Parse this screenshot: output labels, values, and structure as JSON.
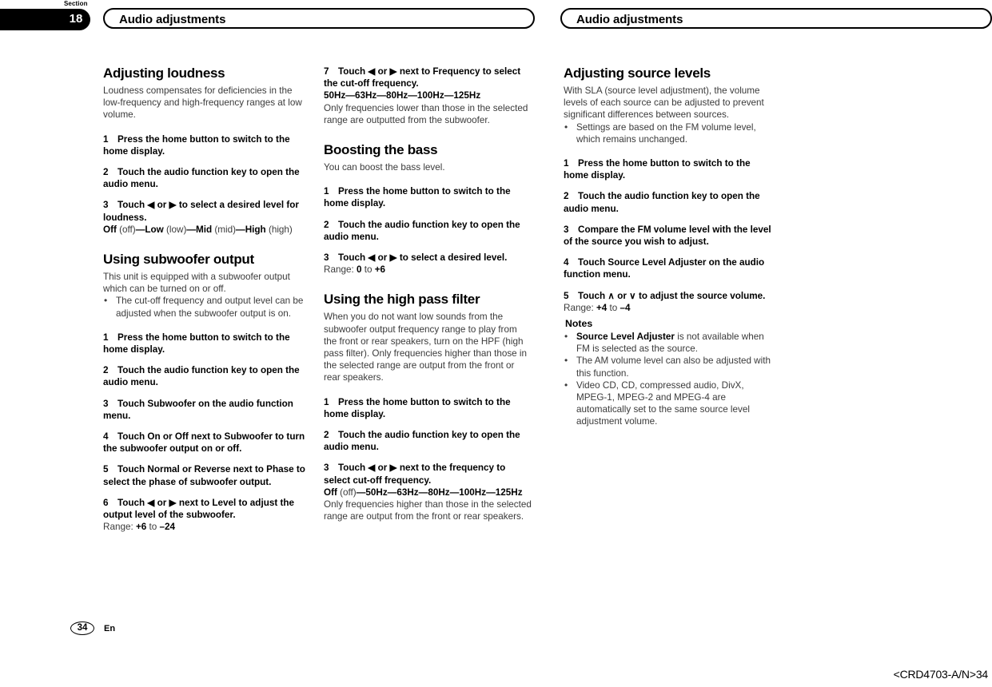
{
  "header": {
    "section_word": "Section",
    "section_number": "18",
    "left_title": "Audio adjustments",
    "right_title": "Audio adjustments"
  },
  "footer": {
    "page_number": "34",
    "language_code": "En",
    "doc_code": "<CRD4703-A/N>34"
  },
  "columns": {
    "col1": {
      "s1": {
        "title": "Adjusting loudness",
        "intro": "Loudness compensates for deficiencies in the low-frequency and high-frequency ranges at low volume.",
        "step1": "Press the home button to switch to the home display.",
        "step2": "Touch the audio function key to open the audio menu.",
        "step3": "Touch ◀ or ▶ to select a desired level for loudness.",
        "opt_off": "Off",
        "opt_off_lc": "(off)",
        "opt_low": "Low",
        "opt_low_lc": "(low)",
        "opt_mid": "Mid",
        "opt_mid_lc": "(mid)",
        "opt_high": "High",
        "opt_high_lc": "(high)",
        "dash": "—"
      },
      "s2": {
        "title": "Using subwoofer output",
        "intro": "This unit is equipped with a subwoofer output which can be turned on or off.",
        "bullet1": "The cut-off frequency and output level can be adjusted when the subwoofer output is on.",
        "step1": "Press the home button to switch to the home display.",
        "step2": "Touch the audio function key to open the audio menu.",
        "step3": "Touch Subwoofer on the audio function menu.",
        "step4": "Touch On or Off next to Subwoofer to turn the subwoofer output on or off.",
        "step5": "Touch Normal or Reverse next to Phase to select the phase of subwoofer output.",
        "step6": "Touch ◀ or ▶ next to Level to adjust the output level of the subwoofer.",
        "range_label": "Range: ",
        "range_from": "+6",
        "range_to_word": " to ",
        "range_to": "–24"
      }
    },
    "col2": {
      "s2cont": {
        "step7": "Touch ◀ or ▶ next to Frequency to select the cut-off frequency.",
        "freq_list": "50Hz—63Hz—80Hz—100Hz—125Hz",
        "note": "Only frequencies lower than those in the selected range are outputted from the subwoofer."
      },
      "s3": {
        "title": "Boosting the bass",
        "intro": "You can boost the bass level.",
        "step1": "Press the home button to switch to the home display.",
        "step2": "Touch the audio function key to open the audio menu.",
        "step3": "Touch ◀ or ▶ to select a desired level.",
        "range_label": "Range: ",
        "range_from": "0",
        "range_to_word": " to ",
        "range_to": "+6"
      },
      "s4": {
        "title": "Using the high pass filter",
        "intro": "When you do not want low sounds from the subwoofer output frequency range to play from the front or rear speakers, turn on the HPF (high pass filter). Only frequencies higher than those in the selected range are output from the front or rear speakers.",
        "step1": "Press the home button to switch to the home display.",
        "step2": "Touch the audio function key to open the audio menu.",
        "step3": "Touch ◀ or ▶ next to the frequency to select cut-off frequency.",
        "opt_off": "Off",
        "opt_off_lc": "(off)",
        "freq_list": "—50Hz—63Hz—80Hz—100Hz—125Hz",
        "note": "Only frequencies higher than those in the selected range are output from the front or rear speakers."
      }
    },
    "col3": {
      "s5": {
        "title": "Adjusting source levels",
        "intro": "With SLA (source level adjustment), the volume levels of each source can be adjusted to prevent significant differences between sources.",
        "bullet1": "Settings are based on the FM volume level, which remains unchanged.",
        "step1": "Press the home button to switch to the home display.",
        "step2": "Touch the audio function key to open the audio menu.",
        "step3": "Compare the FM volume level with the level of the source you wish to adjust.",
        "step4": "Touch Source Level Adjuster on the audio function menu.",
        "step5": "Touch ∧ or ∨ to adjust the source volume.",
        "range_label": "Range: ",
        "range_from": "+4",
        "range_to_word": " to ",
        "range_to": "–4",
        "notes_heading": "Notes",
        "note1_bold": "Source Level Adjuster",
        "note1_rest": " is not available when FM is selected as the source.",
        "note2": "The AM volume level can also be adjusted with this function.",
        "note3": "Video CD, CD, compressed audio, DivX, MPEG-1, MPEG-2 and MPEG-4 are automatically set to the same source level adjustment volume."
      }
    }
  },
  "step_numbers": {
    "n1": "1",
    "n2": "2",
    "n3": "3",
    "n4": "4",
    "n5": "5",
    "n6": "6",
    "n7": "7"
  }
}
